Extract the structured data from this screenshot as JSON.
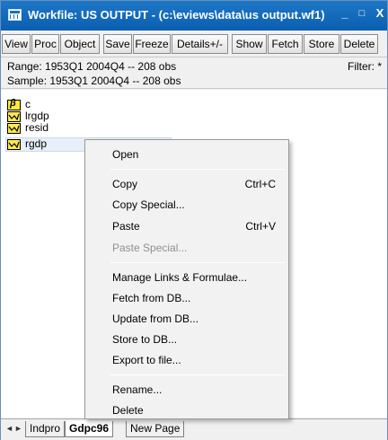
{
  "window": {
    "title": "Workfile: US OUTPUT - (c:\\eviews\\data\\us output.wf1)",
    "controls": {
      "minimize": "_",
      "maximize": "□",
      "close": "X"
    }
  },
  "toolbar": {
    "buttons": [
      "View",
      "Proc",
      "Object",
      "Save",
      "Freeze",
      "Details+/-",
      "Show",
      "Fetch",
      "Store",
      "Delete"
    ]
  },
  "info": {
    "range": "Range:  1953Q1 2004Q4  --  208 obs",
    "sample": "Sample: 1953Q1 2004Q4  --  208 obs",
    "filter": "Filter: *"
  },
  "objects": [
    {
      "name": "c",
      "icon": "coefficient-icon"
    },
    {
      "name": "lrgdp",
      "icon": "series-icon"
    },
    {
      "name": "resid",
      "icon": "series-icon"
    },
    {
      "name": "rgdp",
      "icon": "series-icon",
      "selected": true
    }
  ],
  "context_menu": {
    "items": [
      {
        "label": "Open"
      },
      {
        "label": "Copy",
        "shortcut": "Ctrl+C"
      },
      {
        "label": "Copy Special..."
      },
      {
        "label": "Paste",
        "shortcut": "Ctrl+V"
      },
      {
        "label": "Paste Special...",
        "disabled": true
      },
      {
        "label": "Manage Links & Formulae..."
      },
      {
        "label": "Fetch from DB..."
      },
      {
        "label": "Update from DB..."
      },
      {
        "label": "Store to DB..."
      },
      {
        "label": "Export to file..."
      },
      {
        "label": "Rename..."
      },
      {
        "label": "Delete"
      }
    ]
  },
  "tabs": {
    "nav_left": "◄",
    "nav_right": "►",
    "items": [
      {
        "label": "Indpro"
      },
      {
        "label": "Gdpc96",
        "active": true
      },
      {
        "label": "New Page"
      }
    ]
  },
  "colors": {
    "titlebar": "#0b5fb0",
    "selection": "#e7eff9",
    "series_icon": "#ffe84d"
  }
}
